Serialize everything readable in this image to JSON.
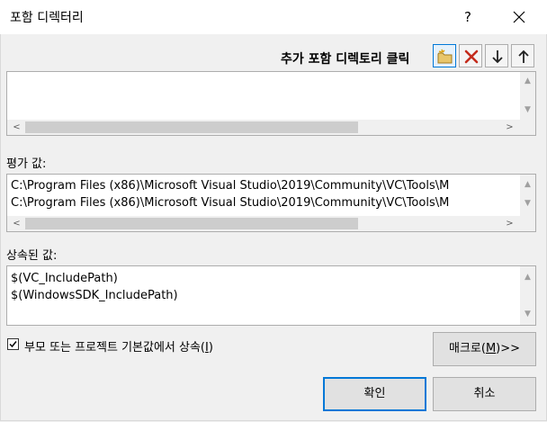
{
  "window": {
    "title": "포함 디렉터리",
    "help_glyph": "?",
    "close_glyph": "✕"
  },
  "toolbar": {
    "label": "추가 포함 디렉토리 클릭",
    "buttons": [
      {
        "name": "new-folder-icon"
      },
      {
        "name": "delete-icon",
        "color": "#c42b1c"
      },
      {
        "name": "arrow-down-icon"
      },
      {
        "name": "arrow-up-icon"
      }
    ]
  },
  "evaluated": {
    "label": "평가 값:",
    "lines": [
      "C:\\Program Files (x86)\\Microsoft Visual Studio\\2019\\Community\\VC\\Tools\\M",
      "C:\\Program Files (x86)\\Microsoft Visual Studio\\2019\\Community\\VC\\Tools\\M"
    ]
  },
  "inherited": {
    "label": "상속된 값:",
    "lines": [
      "$(VC_IncludePath)",
      "$(WindowsSDK_IncludePath)"
    ]
  },
  "inherit_option": {
    "label_prefix": "부모 또는 프로젝트 기본값에서 상속(",
    "accel": "I",
    "label_suffix": ")",
    "checked": true
  },
  "macros_button": {
    "prefix": "매크로(",
    "accel": "M",
    "suffix": ")>>"
  },
  "ok_button": {
    "label": "확인"
  },
  "cancel_button": {
    "label": "취소"
  },
  "colors": {
    "accent": "#0078d7"
  }
}
